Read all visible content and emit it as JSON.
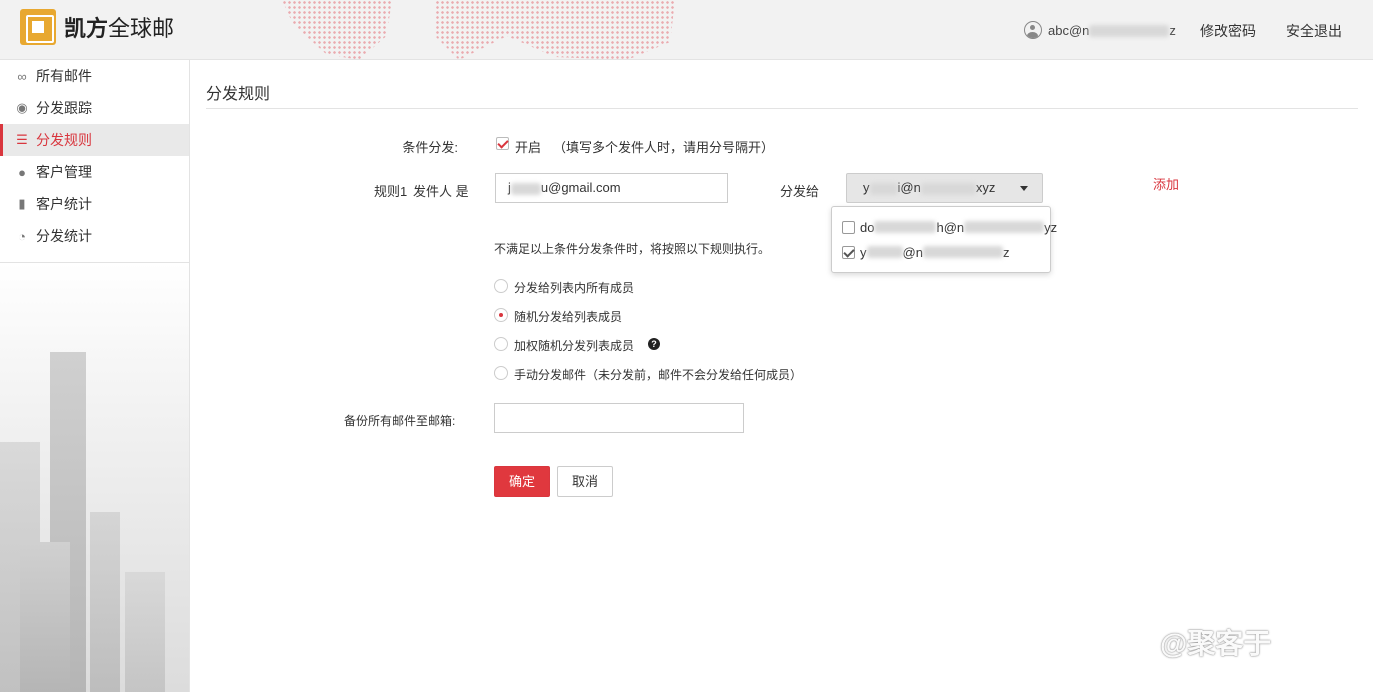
{
  "header": {
    "brand_bold": "凯方",
    "brand_rest": "全球邮",
    "user_prefix": "abc@n",
    "user_suffix": "z",
    "change_password": "修改密码",
    "logout": "安全退出"
  },
  "sidebar": {
    "items": [
      {
        "label": "所有邮件",
        "icon": "infinity-icon",
        "glyph": "∞"
      },
      {
        "label": "分发跟踪",
        "icon": "eye-icon",
        "glyph": "◉"
      },
      {
        "label": "分发规则",
        "icon": "list-icon",
        "glyph": "☰"
      },
      {
        "label": "客户管理",
        "icon": "user-icon",
        "glyph": "👤"
      },
      {
        "label": "客户统计",
        "icon": "bar-chart-icon",
        "glyph": "▮"
      },
      {
        "label": "分发统计",
        "icon": "pie-chart-icon",
        "glyph": "◔"
      }
    ],
    "active_index": 2
  },
  "main": {
    "title": "分发规则",
    "condition_label": "条件分发:",
    "condition_enabled_label": "开启",
    "condition_hint": "（填写多个发件人时，请用分号隔开）",
    "rule_label": "规则1",
    "sender_label": "发件人 是",
    "sender_prefix": "j",
    "sender_suffix": "u@gmail.com",
    "distribute_to_label": "分发给",
    "select_prefix": "y",
    "select_mid": "i@n",
    "select_suffix": "xyz",
    "add_label": "添加",
    "dropdown_options": [
      {
        "prefix": "do",
        "mid": "h@n",
        "suffix": "yz",
        "checked": false
      },
      {
        "prefix": "y",
        "mid": "@n",
        "suffix": "z",
        "checked": true
      }
    ],
    "fallback_text": "不满足以上条件分发条件时，将按照以下规则执行。",
    "radio_options": [
      {
        "label": "分发给列表内所有成员",
        "selected": false
      },
      {
        "label": "随机分发给列表成员",
        "selected": true
      },
      {
        "label": "加权随机分发列表成员",
        "selected": false
      },
      {
        "label": "手动分发邮件（未分发前，邮件不会分发给任何成员）",
        "selected": false
      }
    ],
    "backup_label": "备份所有邮件至邮箱:",
    "backup_value": "",
    "ok_label": "确定",
    "cancel_label": "取消"
  },
  "watermark": "@聚客于",
  "colors": {
    "accent": "#d9363e",
    "topbar": "#f2f2f2"
  }
}
